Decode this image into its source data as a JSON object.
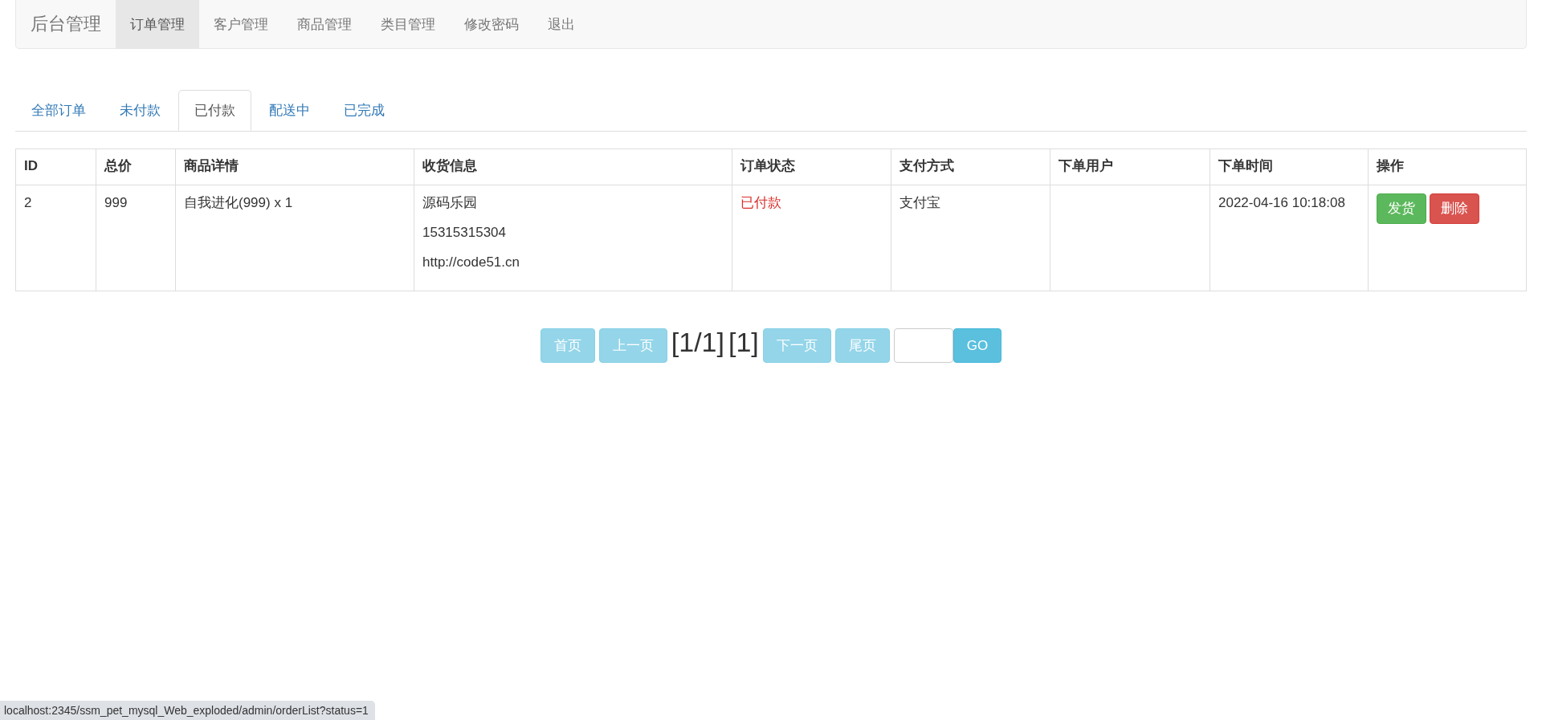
{
  "navbar": {
    "brand": "后台管理",
    "items": [
      {
        "label": "订单管理",
        "selected": true
      },
      {
        "label": "客户管理",
        "selected": false
      },
      {
        "label": "商品管理",
        "selected": false
      },
      {
        "label": "类目管理",
        "selected": false
      },
      {
        "label": "修改密码",
        "selected": false
      },
      {
        "label": "退出",
        "selected": false
      }
    ]
  },
  "tabs": [
    {
      "label": "全部订单",
      "selected": false
    },
    {
      "label": "未付款",
      "selected": false
    },
    {
      "label": "已付款",
      "selected": true
    },
    {
      "label": "配送中",
      "selected": false
    },
    {
      "label": "已完成",
      "selected": false
    }
  ],
  "table": {
    "columns": [
      "ID",
      "总价",
      "商品详情",
      "收货信息",
      "订单状态",
      "支付方式",
      "下单用户",
      "下单时间",
      "操作"
    ],
    "rows": [
      {
        "id": "2",
        "total": "999",
        "product": "自我进化(999) x 1",
        "shipping": [
          "源码乐园",
          "15315315304",
          "http://code51.cn"
        ],
        "status": "已付款",
        "payment": "支付宝",
        "time": "2022-04-16 10:18:08",
        "actions": [
          {
            "label": "发货",
            "kind": "success"
          },
          {
            "label": "删除",
            "kind": "danger"
          }
        ]
      }
    ]
  },
  "pager": {
    "items": [
      {
        "kind": "button",
        "label": "首页",
        "disabled": true
      },
      {
        "kind": "button",
        "label": "上一页",
        "disabled": true
      },
      {
        "kind": "text",
        "label": "[1/1]"
      },
      {
        "kind": "text",
        "label": "[1]"
      },
      {
        "kind": "button",
        "label": "下一页",
        "disabled": true
      },
      {
        "kind": "button",
        "label": "尾页",
        "disabled": true
      },
      {
        "kind": "input"
      },
      {
        "kind": "button",
        "label": "GO",
        "disabled": false
      }
    ]
  },
  "status_bar": {
    "url": "localhost:2345/ssm_pet_mysql_Web_exploded/admin/orderList?status=1"
  }
}
